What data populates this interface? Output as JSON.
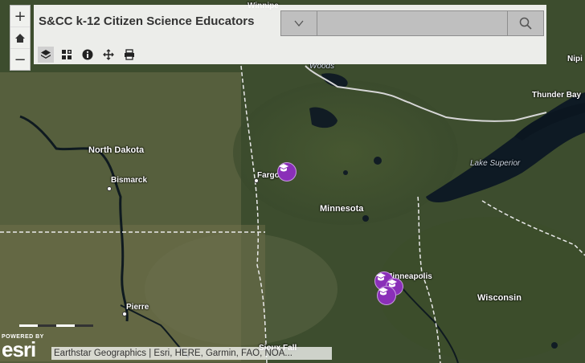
{
  "app": {
    "title": "S&CC k-12 Citizen Science Educators"
  },
  "zoom": {
    "in_label": "+",
    "out_label": "−",
    "home_label": "⌂"
  },
  "search": {
    "value": "",
    "placeholder": ""
  },
  "toolbar": {
    "tools": [
      {
        "name": "layers-icon",
        "active": true
      },
      {
        "name": "basemap-gallery-icon",
        "active": false
      },
      {
        "name": "info-icon",
        "active": false
      },
      {
        "name": "measure-icon",
        "active": false
      },
      {
        "name": "print-icon",
        "active": false
      }
    ]
  },
  "map": {
    "labels": {
      "north_dakota": "North Dakota",
      "minnesota": "Minnesota",
      "wisconsin": "Wisconsin",
      "lake_superior": "Lake Superior",
      "bismarck": "Bismarck",
      "fargo": "Fargo",
      "pierre": "Pierre",
      "minneapolis": "Minneapolis",
      "thunder_bay": "Thunder Bay",
      "woods": "Woods",
      "nipigon_partial": "Nipi",
      "winnipeg_partial": "Winnipe",
      "sioux_falls_partial": "Sioux Fall"
    }
  },
  "attribution": "Earthstar Geographics | Esri, HERE, Garmin, FAO, NOA...",
  "esri_logo": {
    "powered_by": "POWERED BY",
    "name": "esri"
  }
}
